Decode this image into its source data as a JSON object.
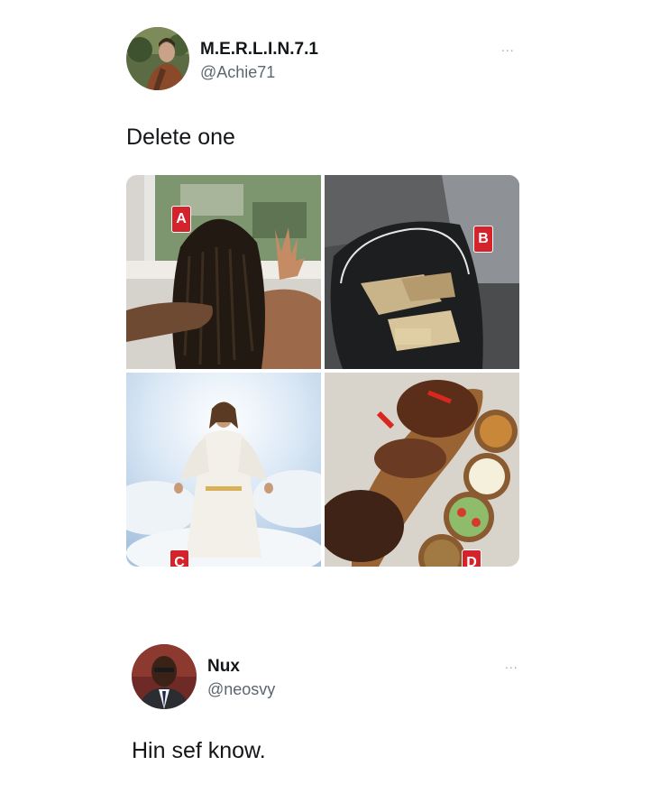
{
  "tweet": {
    "display_name": "M.E.R.L.I.N.7.1",
    "handle": "@Achie71",
    "more": "...",
    "text": "Delete one",
    "images": [
      {
        "label": "A"
      },
      {
        "label": "B"
      },
      {
        "label": "C"
      },
      {
        "label": "D"
      }
    ]
  },
  "reply": {
    "display_name": "Nux",
    "handle": "@neosvy",
    "more": "...",
    "text": "Hin sef know."
  },
  "colors": {
    "badge": "#d4232b",
    "handle": "#5b6670",
    "text": "#14171a"
  }
}
